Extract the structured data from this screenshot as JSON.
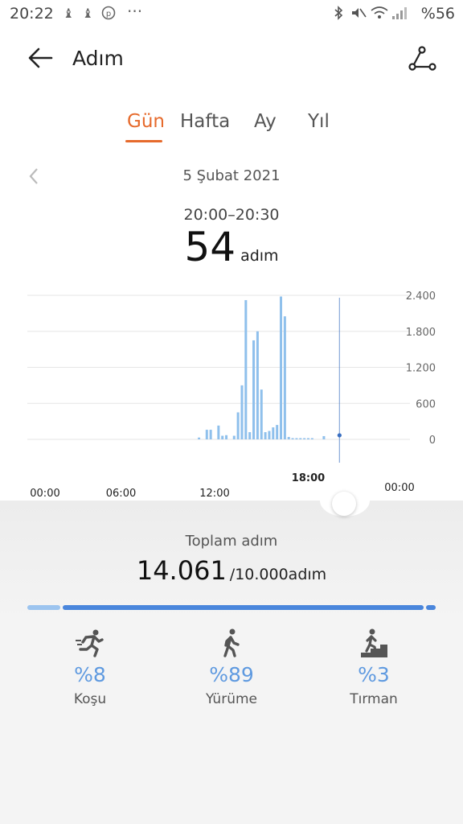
{
  "status_bar": {
    "time": "20:22",
    "notification_icons": [
      "runner-icon",
      "runner-icon",
      "pinterest-icon",
      "more-dots-icon"
    ],
    "system_icons": [
      "bluetooth-icon",
      "mute-icon",
      "wifi-icon",
      "signal-icon"
    ],
    "battery": "%56"
  },
  "header": {
    "title": "Adım"
  },
  "tabs": [
    {
      "label": "Gün",
      "active": true
    },
    {
      "label": "Hafta",
      "active": false
    },
    {
      "label": "Ay",
      "active": false
    },
    {
      "label": "Yıl",
      "active": false
    }
  ],
  "date": "5 Şubat 2021",
  "selection": {
    "range": "20:00–20:30",
    "steps": "54",
    "unit": "adım"
  },
  "chart_data": {
    "type": "bar",
    "x_unit": "hour of day (30-minute bins, start time)",
    "x": [
      11.0,
      11.5,
      11.75,
      12.25,
      12.5,
      12.75,
      13.25,
      13.5,
      13.75,
      14.0,
      14.25,
      14.5,
      14.75,
      15.0,
      15.25,
      15.5,
      15.75,
      16.0,
      16.25,
      16.5,
      16.75,
      17.0,
      17.25,
      17.5,
      17.75,
      18.0,
      18.25,
      19.0
    ],
    "values": [
      30,
      160,
      160,
      230,
      60,
      70,
      60,
      450,
      900,
      2320,
      120,
      1650,
      1800,
      830,
      120,
      140,
      200,
      240,
      2380,
      2050,
      40,
      20,
      20,
      20,
      20,
      20,
      20,
      54
    ],
    "selected_x": 20.0,
    "xlim": [
      0,
      24
    ],
    "ylim": [
      0,
      2400
    ],
    "y_ticks": [
      "2.400",
      "1.800",
      "1.200",
      "600",
      "0"
    ],
    "y_tick_values": [
      2400,
      1800,
      1200,
      600,
      0
    ],
    "x_ticks": [
      "00:00",
      "06:00",
      "12:00",
      "18:00",
      "00:00"
    ],
    "x_tick_values": [
      0,
      6,
      12,
      18,
      24
    ],
    "grid": true,
    "bar_color": "#8fc0ec",
    "highlight_color": "#3a6fc1"
  },
  "summary": {
    "label": "Toplam adım",
    "total": "14.061",
    "goal": "/10.000adım",
    "breakdown_fractions": [
      0.08,
      0.89,
      0.03
    ],
    "colors": {
      "light": "#9cc4ef",
      "main": "#4a86dc"
    }
  },
  "activities": [
    {
      "icon": "running-icon",
      "percent": "%8",
      "label": "Koşu"
    },
    {
      "icon": "walking-icon",
      "percent": "%89",
      "label": "Yürüme"
    },
    {
      "icon": "climbing-icon",
      "percent": "%3",
      "label": "Tırman"
    }
  ]
}
